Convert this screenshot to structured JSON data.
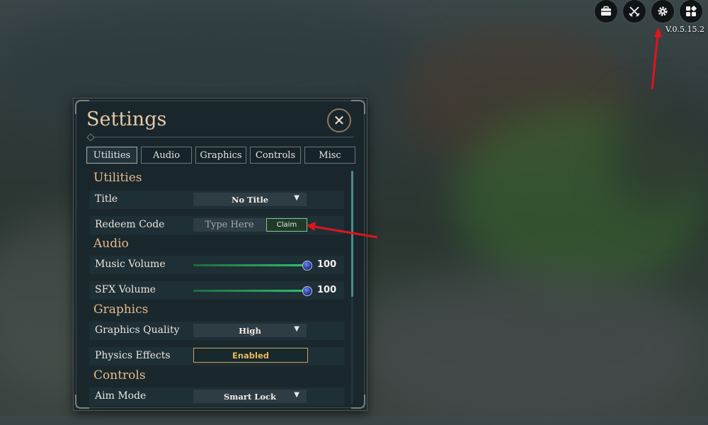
{
  "hud": {
    "buttons": [
      {
        "icon": "briefcase-icon"
      },
      {
        "icon": "crossed-swords-icon"
      },
      {
        "icon": "gear-icon"
      },
      {
        "icon": "grid-icon"
      }
    ],
    "version": "V.0.5.15.2"
  },
  "settings": {
    "title": "Settings",
    "close_icon": "close-icon",
    "tabs": [
      {
        "label": "Utilities",
        "active": true
      },
      {
        "label": "Audio"
      },
      {
        "label": "Graphics"
      },
      {
        "label": "Controls"
      },
      {
        "label": "Misc"
      }
    ],
    "sections": {
      "utilities": {
        "heading": "Utilities",
        "title_label": "Title",
        "title_value": "No Title",
        "redeem_label": "Redeem Code",
        "redeem_placeholder": "Type Here",
        "claim_label": "Claim"
      },
      "audio": {
        "heading": "Audio",
        "music_label": "Music Volume",
        "music_value": "100",
        "music_level": 1.0,
        "sfx_label": "SFX Volume",
        "sfx_value": "100",
        "sfx_level": 1.0
      },
      "graphics": {
        "heading": "Graphics",
        "quality_label": "Graphics Quality",
        "quality_value": "High",
        "physics_label": "Physics Effects",
        "physics_value": "Enabled"
      },
      "controls": {
        "heading": "Controls",
        "aim_label": "Aim Mode",
        "aim_value": "Smart Lock"
      }
    }
  },
  "colors": {
    "accent_heading": "#e5b98e",
    "slider_green": "#2fc26c",
    "toggle_gold": "#e9b95c",
    "annotation_red": "#e0141c"
  }
}
